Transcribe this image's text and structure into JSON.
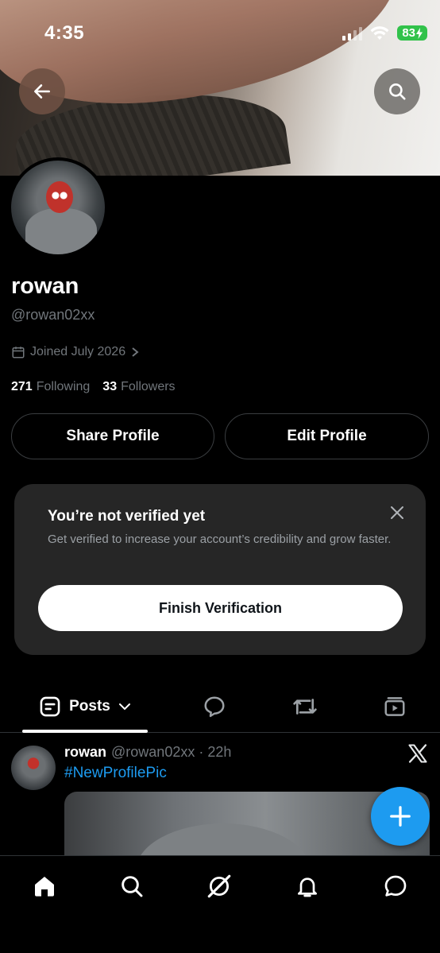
{
  "status_bar": {
    "time": "4:35",
    "battery": "83"
  },
  "profile": {
    "name": "rowan",
    "handle": "@rowan02xx",
    "joined": "Joined July 2026",
    "following_count": "271",
    "following_label": "Following",
    "followers_count": "33",
    "followers_label": "Followers"
  },
  "actions": {
    "share": "Share Profile",
    "edit": "Edit Profile"
  },
  "verify_card": {
    "title": "You’re not verified yet",
    "description": "Get verified to increase your account’s credibility and grow faster.",
    "button": "Finish Verification"
  },
  "tabs": {
    "posts": "Posts"
  },
  "post": {
    "name": "rowan",
    "meta": "@rowan02xx · 22h",
    "text": "#NewProfilePic"
  },
  "colors": {
    "accent": "#1d9bf0",
    "verify_bg": "#262626",
    "battery": "#31c24a"
  }
}
